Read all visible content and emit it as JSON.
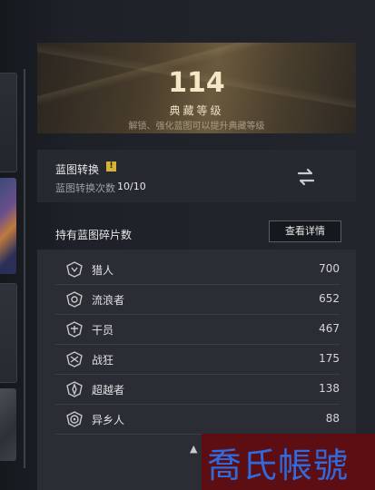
{
  "collection": {
    "level": "114",
    "title": "典藏等级",
    "subtitle": "解锁、强化蓝图可以提升典藏等级"
  },
  "convert": {
    "title": "蓝图转换",
    "info_icon": "!",
    "count_label": "蓝图转换次数",
    "count_value": "10/10",
    "swap_icon": "swap-arrows-icon"
  },
  "shards": {
    "label": "持有蓝图碎片数",
    "detail_button": "查看详情",
    "rows": [
      {
        "name": "猎人",
        "value": "700",
        "icon": "hunter-class-icon"
      },
      {
        "name": "流浪者",
        "value": "652",
        "icon": "wanderer-class-icon"
      },
      {
        "name": "干员",
        "value": "467",
        "icon": "operator-class-icon"
      },
      {
        "name": "战狂",
        "value": "175",
        "icon": "berserker-class-icon"
      },
      {
        "name": "超越者",
        "value": "138",
        "icon": "transcender-class-icon"
      },
      {
        "name": "异乡人",
        "value": "88",
        "icon": "stranger-class-icon"
      }
    ]
  },
  "scroll_hint": "▲",
  "watermark": "喬氏帳號",
  "colors": {
    "accent_gold": "#d8b232",
    "watermark_bg": "#5c0e12",
    "watermark_text": "#2f6bdf"
  }
}
